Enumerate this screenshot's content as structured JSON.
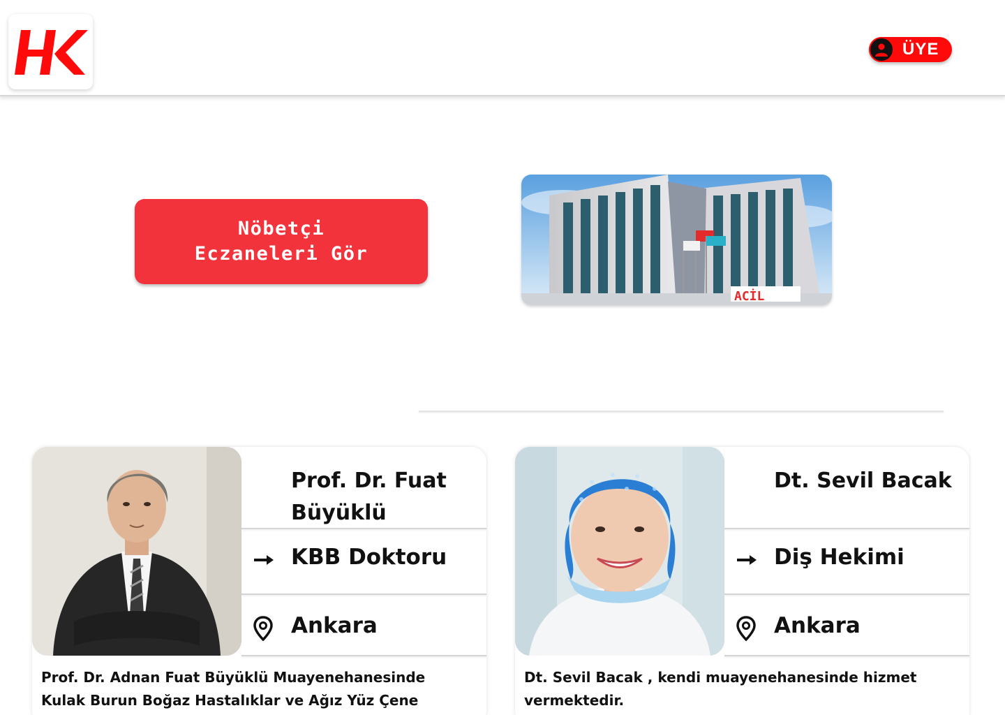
{
  "header": {
    "logo_text": "HK",
    "member_button_label": "ÜYE"
  },
  "pharmacy": {
    "button_label": "Nöbetçi\nEczaneleri Gör"
  },
  "hospital": {
    "sign_text": "ACİL"
  },
  "doctors": [
    {
      "name": "Prof. Dr. Fuat Büyüklü",
      "specialty": "KBB Doktoru",
      "city": "Ankara",
      "description": "Prof. Dr. Adnan Fuat Büyüklü Muayenehanesinde Kulak Burun Boğaz Hastalıklar ve Ağız Yüz Çene"
    },
    {
      "name": "Dt. Sevil Bacak",
      "specialty": "Diş Hekimi",
      "city": "Ankara",
      "description": "Dt. Sevil Bacak , kendi muayenehanesinde hizmet vermektedir."
    }
  ],
  "colors": {
    "brand_red": "#ff0a0a",
    "pharmacy_red": "#f2333b"
  },
  "icons": {
    "specialty": "arrow-right-icon",
    "city": "location-pin-icon",
    "member": "user-icon"
  }
}
